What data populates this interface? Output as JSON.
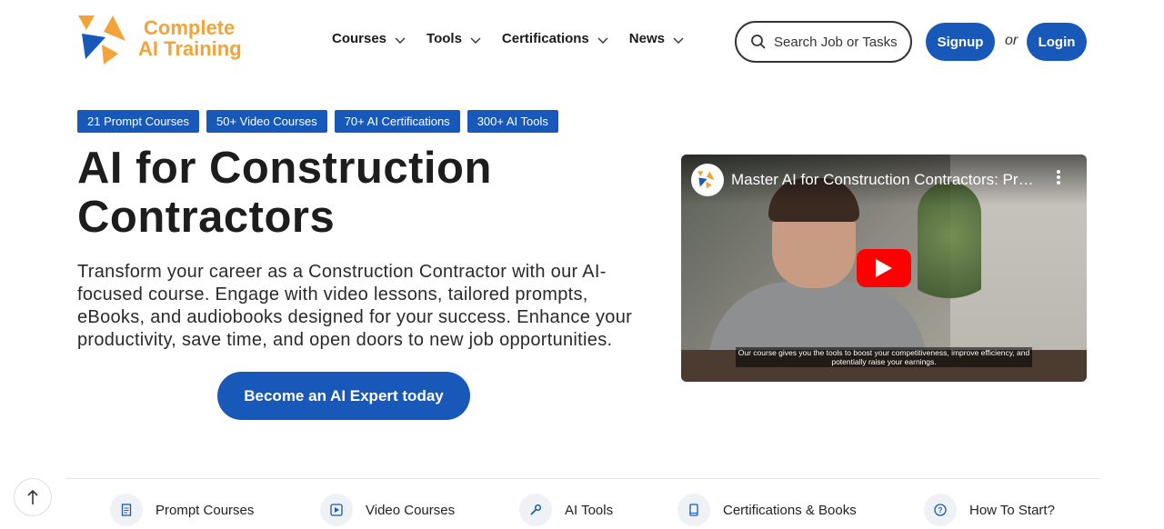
{
  "header": {
    "logo_line1": "Complete",
    "logo_line2": "AI Training",
    "nav": [
      "Courses",
      "Tools",
      "Certifications",
      "News"
    ],
    "search_placeholder": "Search Job or Tasks",
    "signup_label": "Signup",
    "or_label": "or",
    "login_label": "Login"
  },
  "hero": {
    "badges": [
      "21 Prompt Courses",
      "50+ Video Courses",
      "70+ AI Certifications",
      "300+ AI Tools"
    ],
    "title_line1": "AI for Construction",
    "title_line2": "Contractors",
    "description": "Transform your career as a Construction Contractor with our AI-focused course. Engage with video lessons, tailored prompts, eBooks, and audiobooks designed for your success. Enhance your productivity, save time, and open doors to new job opportunities.",
    "cta_label": "Become an AI Expert today"
  },
  "video": {
    "title": "Master AI for Construction Contractors: Prom…",
    "caption": "Our course gives you the tools to boost your competitiveness, improve efficiency, and potentially raise your earnings."
  },
  "bottom_nav": [
    "Prompt Courses",
    "Video Courses",
    "AI Tools",
    "Certifications & Books",
    "How To Start?"
  ],
  "colors": {
    "brand_blue": "#1858b8",
    "logo_orange": "#f2a33a",
    "youtube_red": "#ff0000"
  }
}
